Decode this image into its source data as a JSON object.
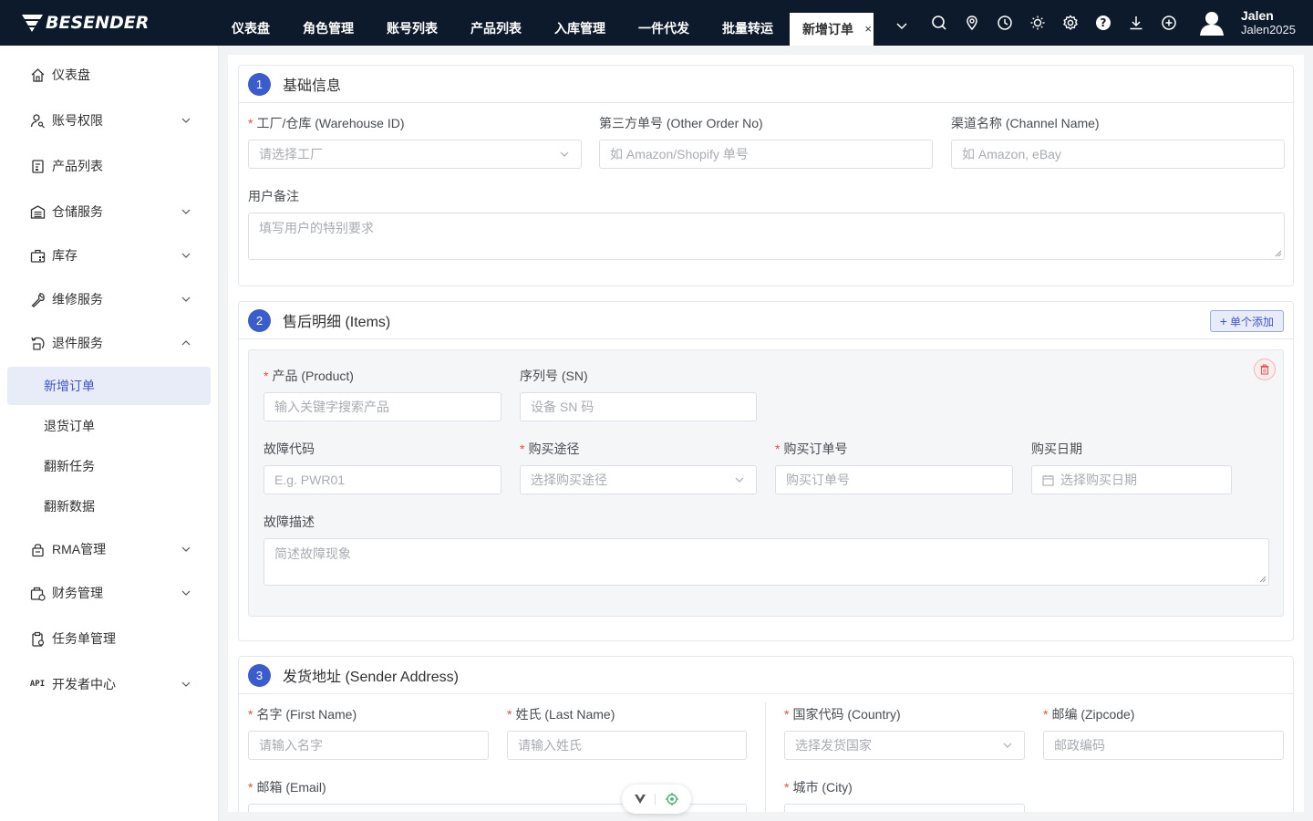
{
  "brand": {
    "name": "BESENDER"
  },
  "nav_tabs": [
    "仪表盘",
    "角色管理",
    "账号列表",
    "产品列表",
    "入库管理",
    "一件代发",
    "批量转运"
  ],
  "active_tab": {
    "label": "新增订单",
    "close": "×"
  },
  "toolbar_icons": [
    "search-icon",
    "location-icon",
    "clock-icon",
    "sun-icon",
    "gear-icon",
    "help-icon",
    "download-icon",
    "plus-circle-icon"
  ],
  "user": {
    "name": "Jalen",
    "account": "Jalen2025"
  },
  "sidebar": {
    "items": [
      {
        "label": "仪表盘",
        "icon": "home-icon"
      },
      {
        "label": "账号权限",
        "icon": "user-key-icon"
      },
      {
        "label": "产品列表",
        "icon": "product-list-icon"
      },
      {
        "label": "仓储服务",
        "icon": "warehouse-icon"
      },
      {
        "label": "库存",
        "icon": "inventory-icon"
      },
      {
        "label": "维修服务",
        "icon": "wrench-icon"
      },
      {
        "label": "退件服务",
        "icon": "return-icon"
      },
      {
        "label": "RMA管理",
        "icon": "rma-lock-icon"
      },
      {
        "label": "财务管理",
        "icon": "finance-icon"
      },
      {
        "label": "任务单管理",
        "icon": "task-clipboard-icon"
      },
      {
        "label": "开发者中心",
        "icon": "api-icon",
        "icon_text": "API"
      }
    ],
    "sub_items": [
      "新增订单",
      "退货订单",
      "翻新任务",
      "翻新数据"
    ]
  },
  "section1": {
    "step": "1",
    "title": "基础信息",
    "warehouse": {
      "label": "工厂/仓库 (Warehouse ID)",
      "placeholder": "请选择工厂"
    },
    "other_order": {
      "label": "第三方单号 (Other Order No)",
      "placeholder": "如 Amazon/Shopify 单号"
    },
    "channel": {
      "label": "渠道名称 (Channel Name)",
      "placeholder": "如 Amazon, eBay"
    },
    "remark": {
      "label": "用户备注",
      "placeholder": "填写用户的特别要求"
    }
  },
  "section2": {
    "step": "2",
    "title": "售后明细 (Items)",
    "add_label": "单个添加",
    "product": {
      "label": "产品 (Product)",
      "placeholder": "输入关键字搜索产品"
    },
    "sn": {
      "label": "序列号 (SN)",
      "placeholder": "设备 SN 码"
    },
    "fault_code": {
      "label": "故障代码",
      "placeholder": "E.g. PWR01"
    },
    "channel": {
      "label": "购买途径",
      "placeholder": "选择购买途径"
    },
    "order_no": {
      "label": "购买订单号",
      "placeholder": "购买订单号"
    },
    "date": {
      "label": "购买日期",
      "placeholder": "选择购买日期"
    },
    "fault_desc": {
      "label": "故障描述",
      "placeholder": "简述故障现象"
    }
  },
  "section3": {
    "step": "3",
    "title": "发货地址 (Sender Address)",
    "first_name": {
      "label": "名字 (First Name)",
      "placeholder": "请输入名字"
    },
    "last_name": {
      "label": "姓氏 (Last Name)",
      "placeholder": "请输入姓氏"
    },
    "country": {
      "label": "国家代码 (Country)",
      "placeholder": "选择发货国家"
    },
    "zipcode": {
      "label": "邮编 (Zipcode)",
      "placeholder": "邮政编码"
    },
    "email": {
      "label": "邮箱 (Email)"
    },
    "city": {
      "label": "城市 (City)"
    }
  },
  "colors": {
    "topbar": "#0c1a2b",
    "accent": "#3b5ccc",
    "required": "#e74c3c",
    "active_menu_bg": "#e8ebf8"
  }
}
